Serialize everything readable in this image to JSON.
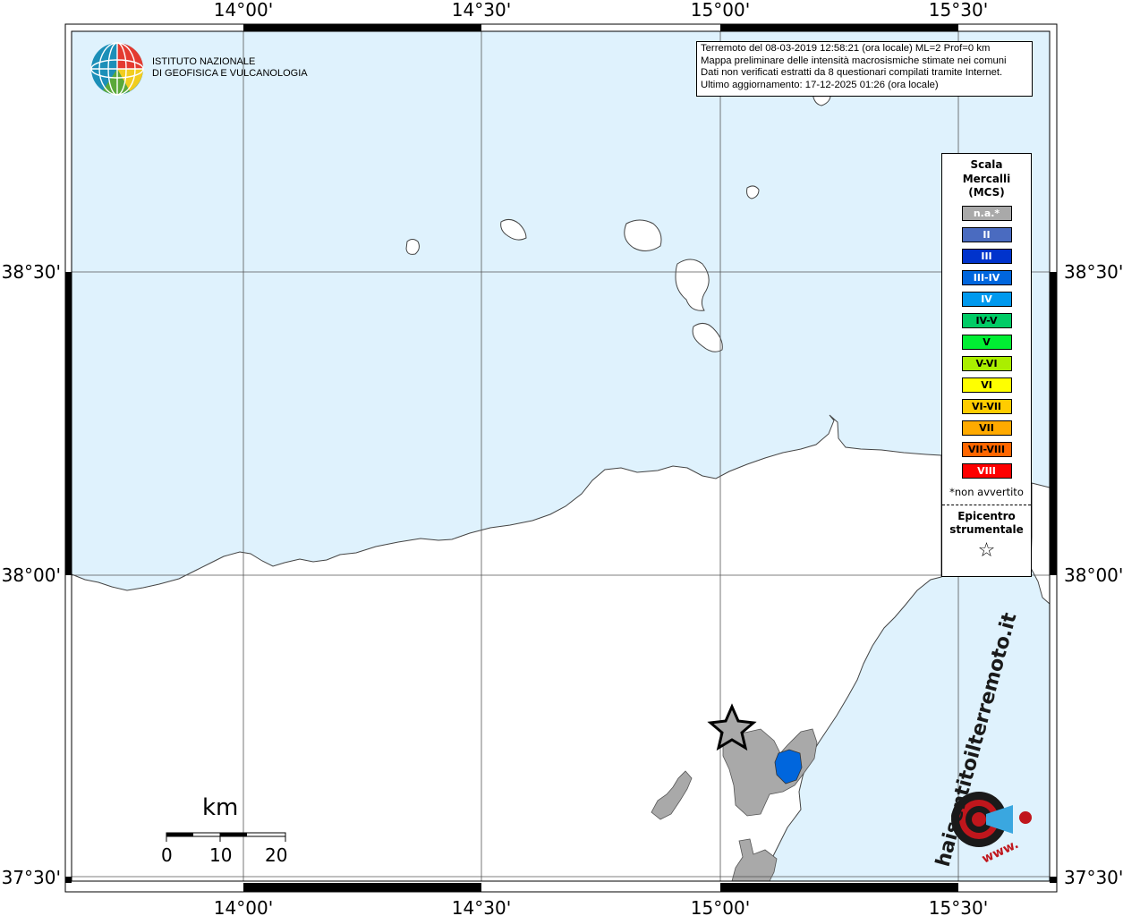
{
  "info_box": {
    "lines": [
      "Terremoto del 08-03-2019 12:58:21 (ora locale) ML=2 Prof=0 km",
      "Mappa preliminare delle intensità macrosismiche stimate nei comuni",
      "Dati non verificati estratti da 8 questionari compilati tramite Internet.",
      "Ultimo aggiornamento: 17-12-2025 01:26 (ora locale)"
    ]
  },
  "logo": {
    "line1": "ISTITUTO NAZIONALE",
    "line2": "DI GEOFISICA E VULCANOLOGIA"
  },
  "axes": {
    "lon_labels": [
      "14°00'",
      "14°30'",
      "15°00'",
      "15°30'"
    ],
    "lat_labels": [
      "38°30'",
      "38°00'",
      "37°30'"
    ]
  },
  "legend": {
    "title": "Scala Mercalli (MCS)",
    "items": [
      {
        "label": "n.a.*",
        "color": "#a9a9a9",
        "text_color": "#ffffff"
      },
      {
        "label": "II",
        "color": "#4a6bc0",
        "text_color": "#ffffff"
      },
      {
        "label": "III",
        "color": "#0033cc",
        "text_color": "#ffffff"
      },
      {
        "label": "III-IV",
        "color": "#0066dd",
        "text_color": "#ffffff"
      },
      {
        "label": "IV",
        "color": "#0099ee",
        "text_color": "#ffffff"
      },
      {
        "label": "IV-V",
        "color": "#00cc66",
        "text_color": "#000000"
      },
      {
        "label": "V",
        "color": "#00ee33",
        "text_color": "#000000"
      },
      {
        "label": "V-VI",
        "color": "#aaee00",
        "text_color": "#000000"
      },
      {
        "label": "VI",
        "color": "#ffff00",
        "text_color": "#000000"
      },
      {
        "label": "VI-VII",
        "color": "#ffcc00",
        "text_color": "#000000"
      },
      {
        "label": "VII",
        "color": "#ffaa00",
        "text_color": "#000000"
      },
      {
        "label": "VII-VIII",
        "color": "#ff6600",
        "text_color": "#000000"
      },
      {
        "label": "VIII",
        "color": "#ff0000",
        "text_color": "#ffffff"
      }
    ],
    "note": "*non avvertito",
    "epicenter_label": "Epicentro strumentale",
    "epicenter_symbol": "☆"
  },
  "scale_bar": {
    "unit": "km",
    "ticks": [
      "0",
      "10",
      "20"
    ]
  },
  "watermark": {
    "text": "haisentitoilterremoto.it",
    "www": "www."
  },
  "colors": {
    "sea": "#dff2fd",
    "land": "#ffffff",
    "affected_gray": "#a9a9a9",
    "affected_blue": "#0066dd"
  }
}
